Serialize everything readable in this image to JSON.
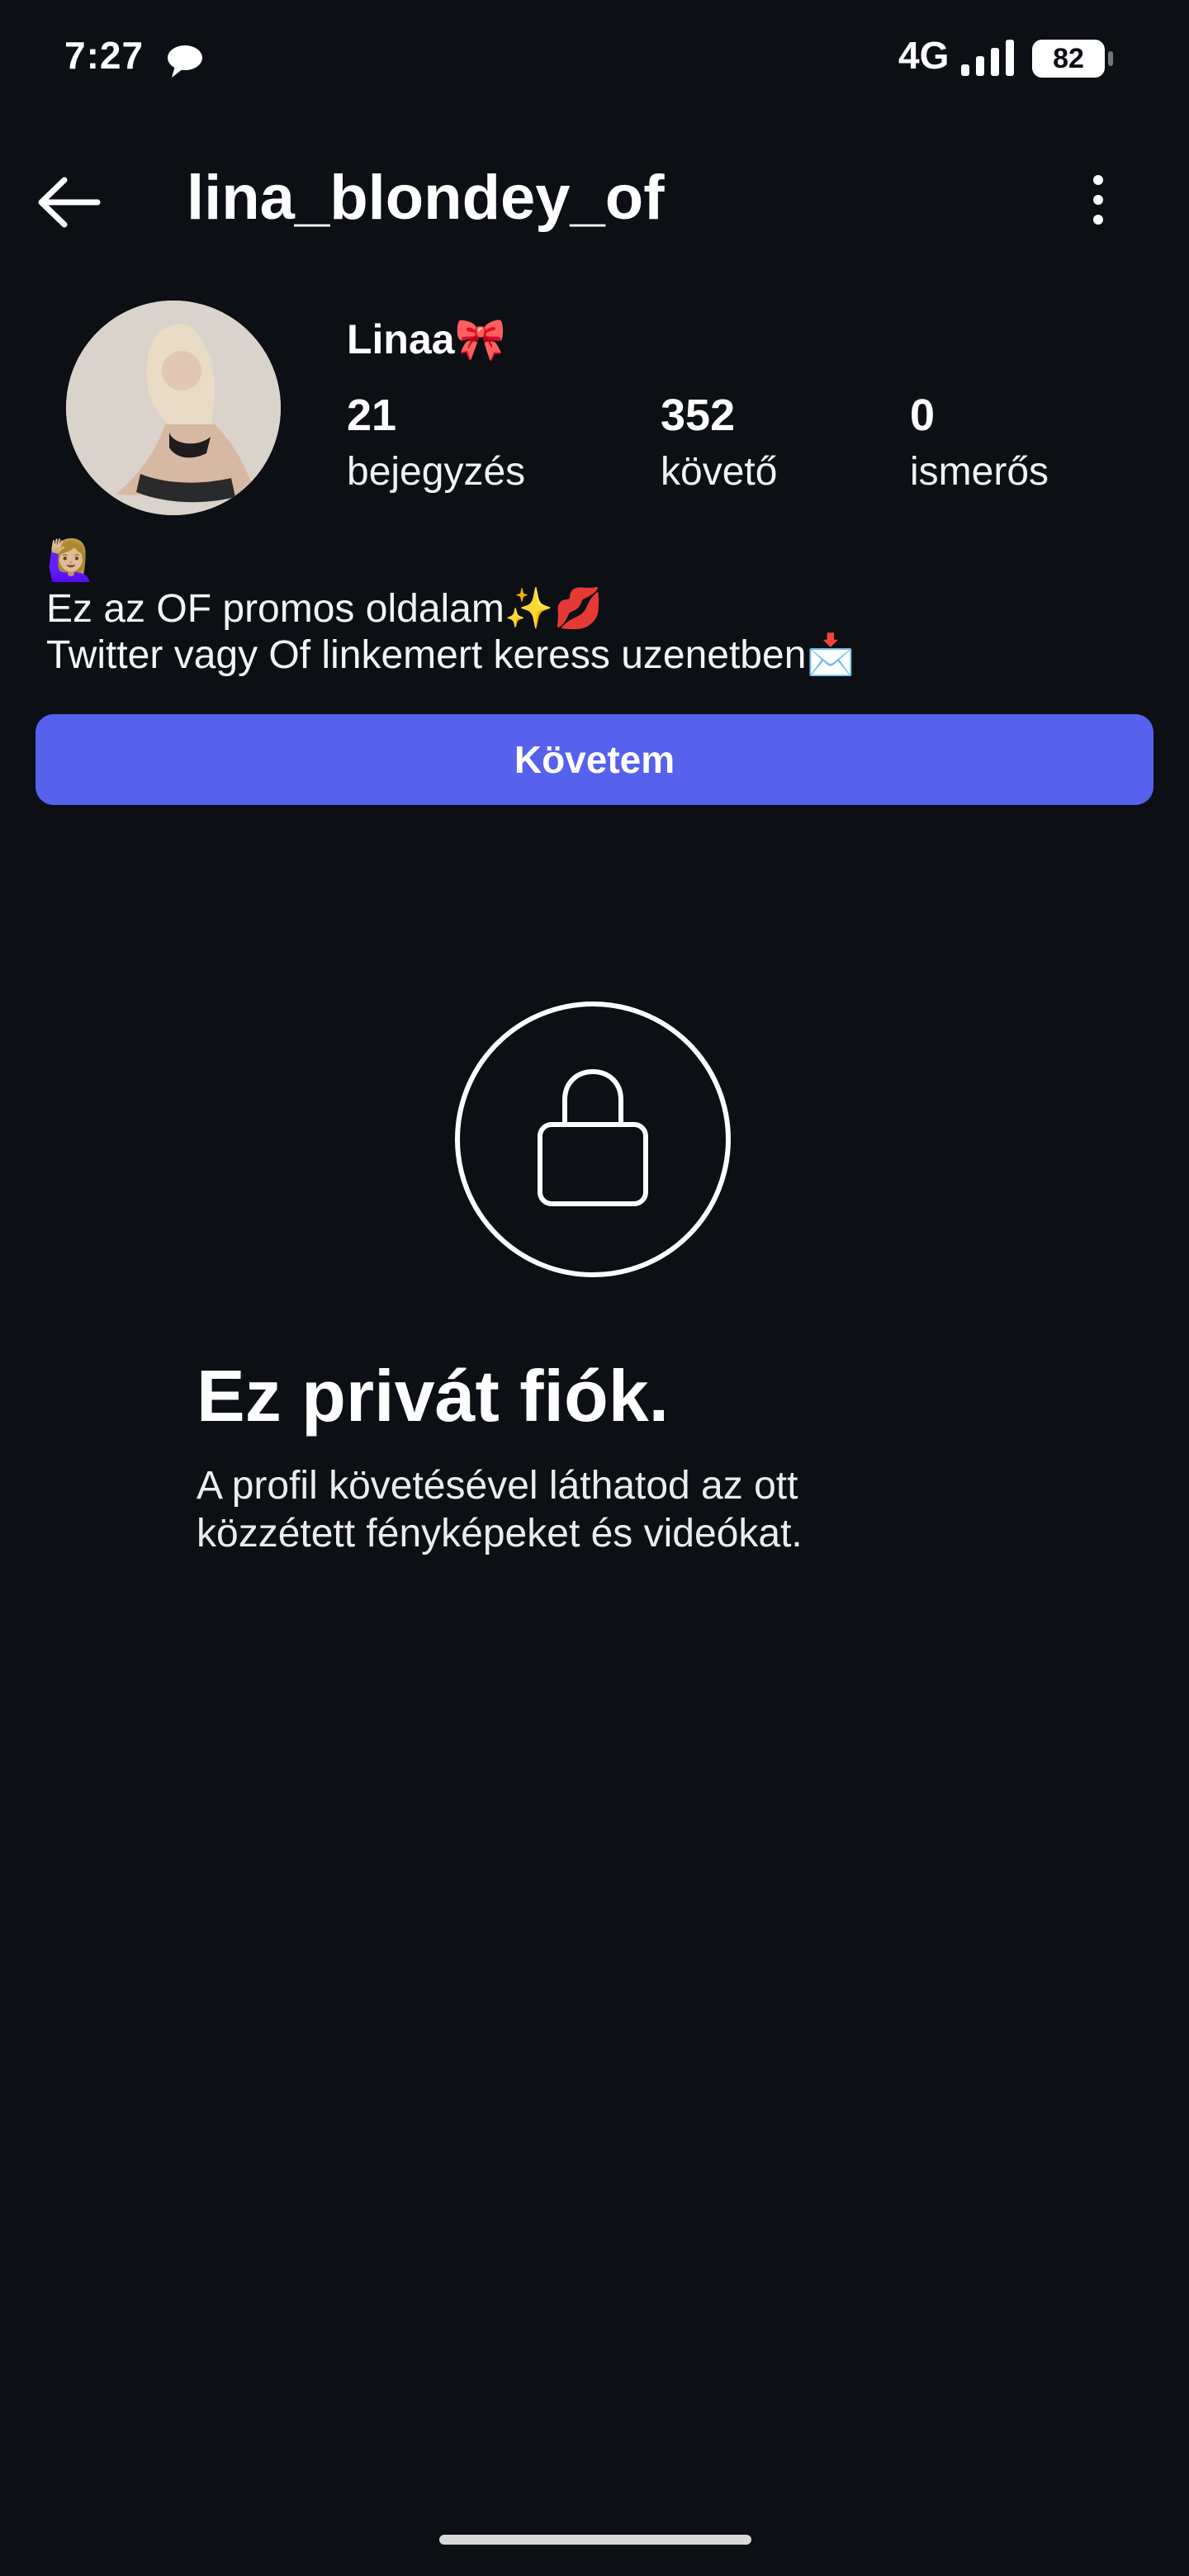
{
  "status_bar": {
    "time": "7:27",
    "network": "4G",
    "battery": "82"
  },
  "header": {
    "username": "lina_blondey_of"
  },
  "profile": {
    "display_name": "Linaa🎀",
    "stats": [
      {
        "value": "21",
        "label": "bejegyzés"
      },
      {
        "value": "352",
        "label": "követő"
      },
      {
        "value": "0",
        "label": "ismerős"
      }
    ],
    "bio": [
      "🙋🏼‍♀️",
      "Ez az OF promos oldalam✨💋",
      "Twitter vagy Of linkemert keress uzenetben📩"
    ],
    "follow_button": "Követem"
  },
  "private_notice": {
    "title": "Ez privát fiók.",
    "description_lines": [
      "A profil követésével láthatod az ott",
      "közzétett fényképeket és videókat."
    ]
  },
  "colors": {
    "background": "#0c0f14",
    "accent": "#5661ee"
  },
  "icons": [
    "chat-bubble-icon",
    "signal-icon",
    "battery-icon",
    "back-arrow-icon",
    "more-vertical-icon",
    "lock-icon"
  ]
}
